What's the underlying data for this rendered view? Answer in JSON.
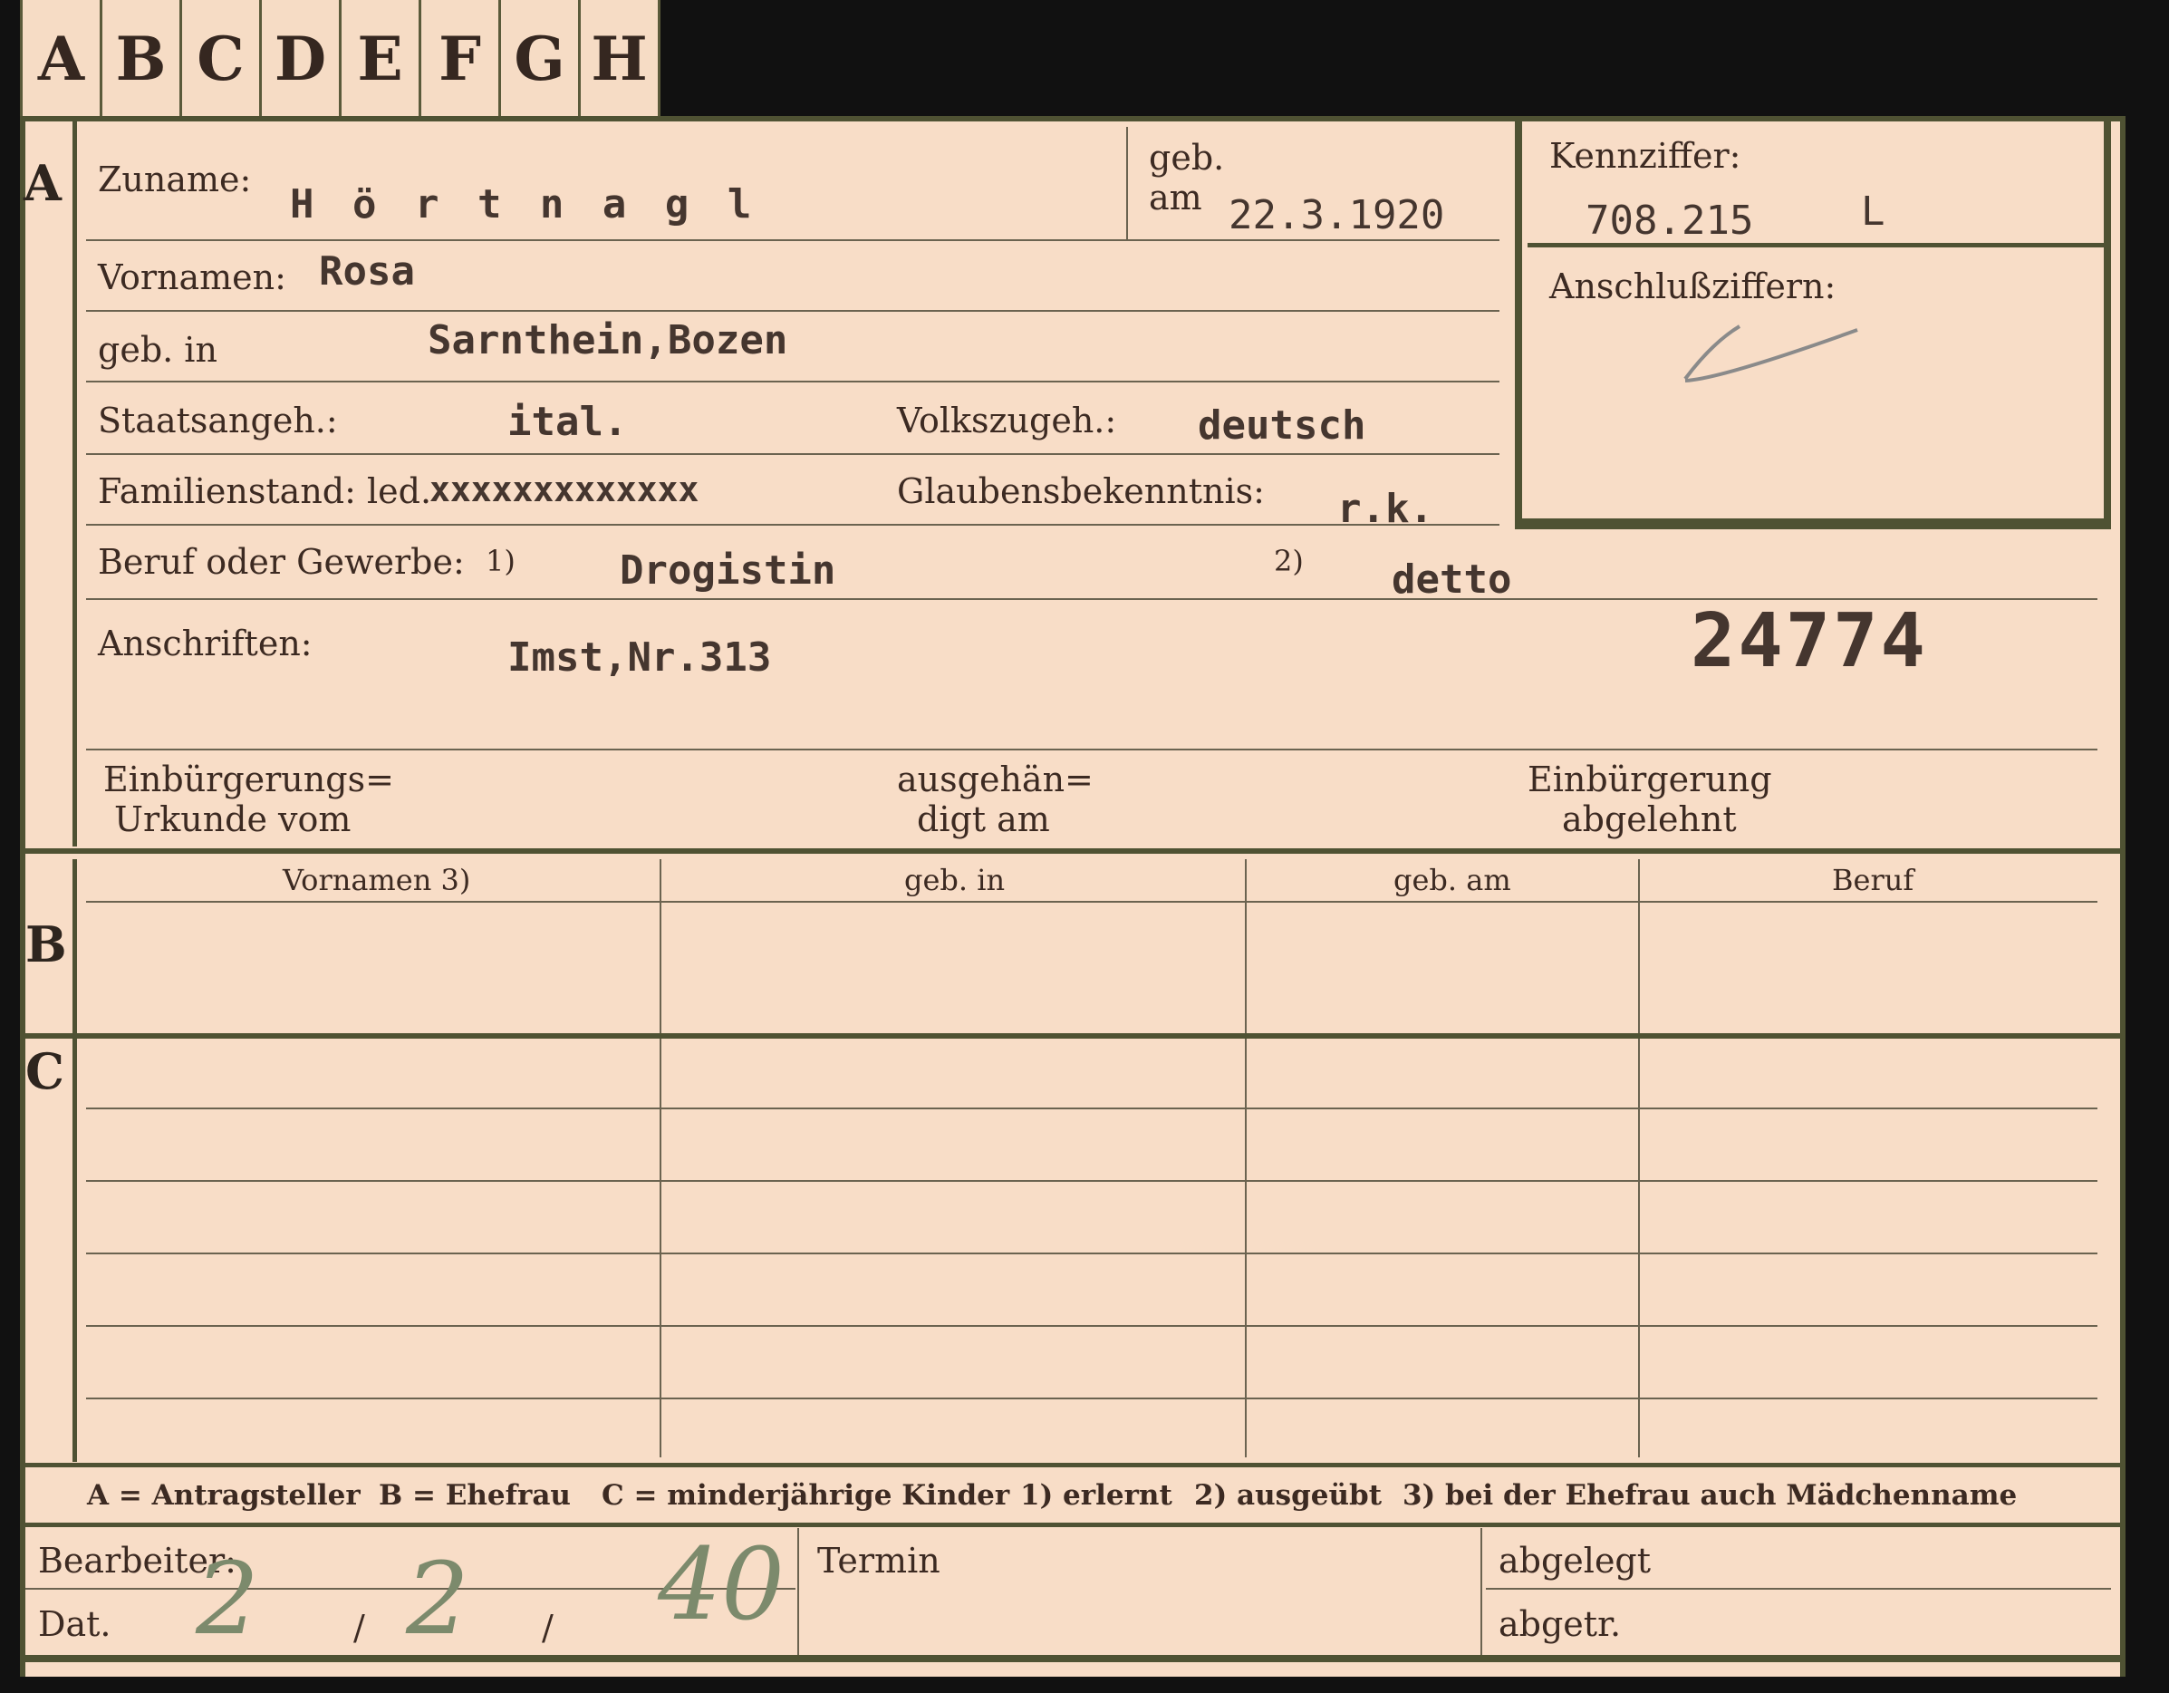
{
  "tabs": [
    "A",
    "B",
    "C",
    "D",
    "E",
    "F",
    "G",
    "H"
  ],
  "sections": {
    "a": "A",
    "b": "B",
    "c": "C"
  },
  "fields": {
    "zuname_label": "Zuname:",
    "zuname_value": "H ö r t n a g l",
    "geb_label": "geb.",
    "am_label": "am",
    "geb_am_value": "22.3.1920",
    "kennziffer_label": "Kennziffer:",
    "kennziffer_value": "708.215",
    "kennziffer_mark": "L",
    "anschluss_label": "Anschlußziffern:",
    "vornamen_label": "Vornamen:",
    "vornamen_value": "Rosa",
    "geb_in_label": "geb. in",
    "geb_in_value": "Sarnthein,Bozen",
    "staatsangeh_label": "Staatsangeh.:",
    "staatsangeh_value": "ital.",
    "volkszugeh_label": "Volkszugeh.:",
    "volkszugeh_value": "deutsch",
    "familienstand_label": "Familienstand: led.",
    "familienstand_struck": "xxxxxxxxxxxxx",
    "glaubens_label": "Glaubensbekenntnis:",
    "glaubens_value": "r.k.",
    "beruf_label": "Beruf oder Gewerbe:",
    "beruf_sup1": "1)",
    "beruf_value1": "Drogistin",
    "beruf_sup2": "2)",
    "beruf_value2": "detto",
    "anschriften_label": "Anschriften:",
    "anschriften_value": "Imst,Nr.313",
    "number": "24774",
    "einb_urkunde_line1": "Einbürgerungs=",
    "einb_urkunde_line2": "Urkunde vom",
    "ausgehaend_line1": "ausgehän=",
    "ausgehaend_line2": "digt am",
    "abgelehnt_line1": "Einbürgerung",
    "abgelehnt_line2": "abgelehnt"
  },
  "table_headers": [
    "Vornamen 3)",
    "geb. in",
    "geb. am",
    "Beruf"
  ],
  "legend": {
    "a": "A = Antragsteller",
    "b": "B = Ehefrau",
    "c": "C = minderjährige Kinder",
    "n1": "1) erlernt",
    "n2": "2) ausgeübt",
    "n3": "3) bei der Ehefrau auch Mädchenname"
  },
  "footer": {
    "bearbeiter_label": "Bearbeiter:",
    "dat_label": "Dat.",
    "dat_day": "2",
    "dat_month": "2",
    "dat_year": "40",
    "sep": "/",
    "termin_label": "Termin",
    "abgelegt_label": "abgelegt",
    "abgetr_label": "abgetr."
  }
}
